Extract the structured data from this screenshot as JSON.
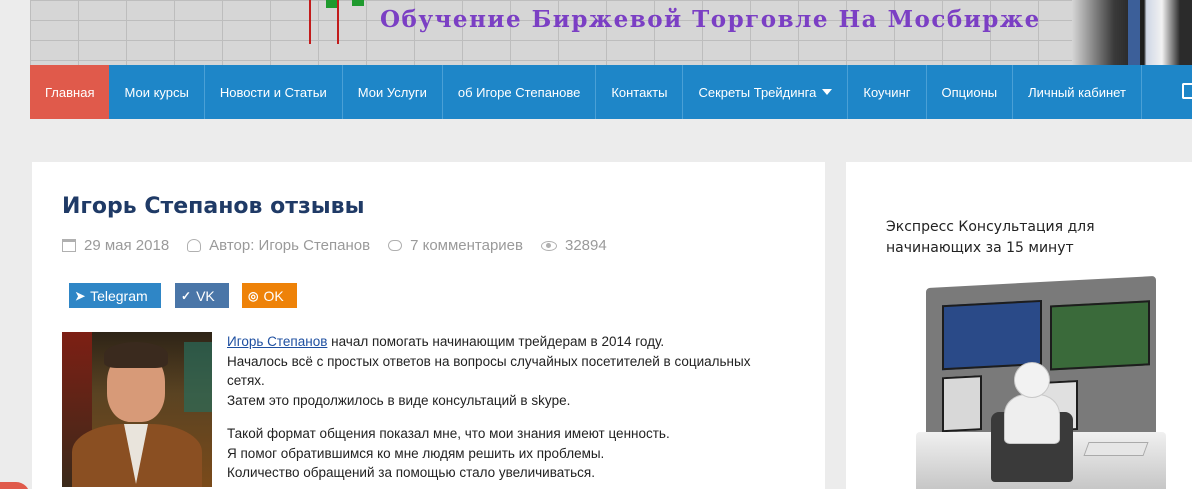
{
  "header": {
    "site_title": "Обучение Биржевой Торговле На Мосбирже"
  },
  "nav": {
    "items": [
      {
        "label": "Главная",
        "active": true
      },
      {
        "label": "Мои курсы"
      },
      {
        "label": "Новости и Статьи"
      },
      {
        "label": "Мои Услуги"
      },
      {
        "label": "об Игоре Степанове"
      },
      {
        "label": "Контакты"
      },
      {
        "label": "Секреты Трейдинга",
        "has_dropdown": true
      },
      {
        "label": "Коучинг"
      },
      {
        "label": "Опционы"
      },
      {
        "label": "Личный кабинет"
      }
    ],
    "cart_icon": "cart-icon"
  },
  "post": {
    "title": "Игорь Степанов отзывы",
    "date": "29 мая 2018",
    "author": "Автор: Игорь Степанов",
    "comments": "7 комментариев",
    "views": "32894"
  },
  "share": {
    "telegram": "Telegram",
    "vk": "VK",
    "ok": "OK"
  },
  "body": {
    "author_link": "Игорь Степанов",
    "p1_rest": " начал помогать начинающим трейдерам в 2014 году.",
    "p2": "Началось всё с простых ответов на вопросы случайных посетителей в социальных сетях.",
    "p3": "Затем это продолжилось в виде консультаций в skype.",
    "p4": "Такой формат общения показал мне, что мои знания имеют ценность.",
    "p5": "Я помог обратившимся ко мне людям решить их проблемы.",
    "p6": "Количество обращений за помощью стало увеличиваться."
  },
  "sidebar": {
    "widget_title": "Экспресс Консультация для начинающих за 15 минут"
  },
  "colors": {
    "nav_bg": "#1e86c8",
    "nav_active": "#e05a4b",
    "title_purple": "#7b3fc4",
    "telegram": "#2f86c6",
    "vk": "#4a76a8",
    "ok": "#ee8208"
  }
}
